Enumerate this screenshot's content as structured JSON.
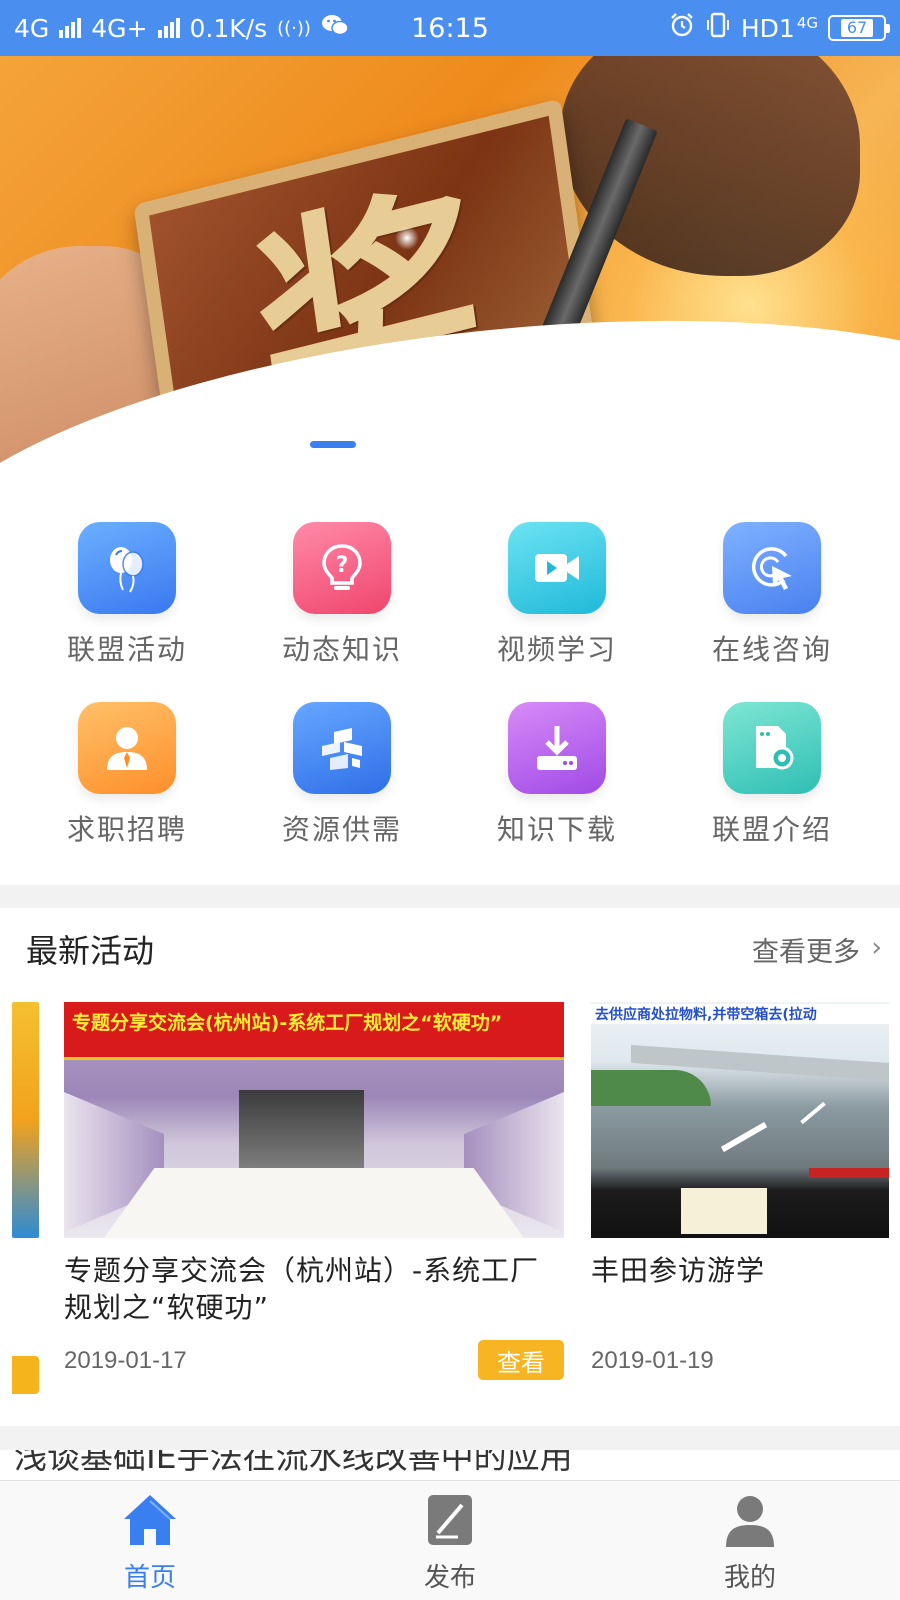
{
  "status_bar": {
    "network_1": "4G",
    "network_2": "4G+",
    "speed": "0.1K/s",
    "time": "16:15",
    "hd_label": "HD1",
    "net_small": "4G",
    "battery": "67"
  },
  "banner": {
    "seal_char": "奖",
    "slide_count": 5,
    "active_slide": 0
  },
  "menu": {
    "items": [
      {
        "label": "联盟活动",
        "icon": "balloons-icon",
        "color": "#3a78f0"
      },
      {
        "label": "动态知识",
        "icon": "lightbulb-question-icon",
        "color": "#f0456d"
      },
      {
        "label": "视频学习",
        "icon": "video-camera-icon",
        "color": "#1fb9d9"
      },
      {
        "label": "在线咨询",
        "icon": "cursor-click-icon",
        "color": "#4a80f0"
      },
      {
        "label": "求职招聘",
        "icon": "person-tie-icon",
        "color": "#ff8f2a"
      },
      {
        "label": "资源供需",
        "icon": "cube-resources-icon",
        "color": "#2f6fe8"
      },
      {
        "label": "知识下载",
        "icon": "download-icon",
        "color": "#a04ae6"
      },
      {
        "label": "联盟介绍",
        "icon": "document-gear-icon",
        "color": "#2ebfb4"
      }
    ]
  },
  "activities": {
    "title": "最新活动",
    "more": "查看更多",
    "cards": [
      {
        "title": "专题分享交流会（杭州站）-系统工厂规划之“软硬功”",
        "date": "2019-01-17",
        "button": "查看",
        "image_banner": "专题分享交流会(杭州站)-系统工厂规划之“软硬功”"
      },
      {
        "title": "丰田参访游学",
        "date": "2019-01-19",
        "image_caption": "去供应商处拉物料,并带空箱去(拉动"
      }
    ]
  },
  "next_section": {
    "title": "浅谈基础IE手法在流水线改善中的应用"
  },
  "bottom_nav": {
    "items": [
      {
        "label": "首页",
        "icon": "home-icon",
        "active": true
      },
      {
        "label": "发布",
        "icon": "edit-note-icon",
        "active": false
      },
      {
        "label": "我的",
        "icon": "user-icon",
        "active": false
      }
    ],
    "active_color": "#3a7ff0"
  }
}
